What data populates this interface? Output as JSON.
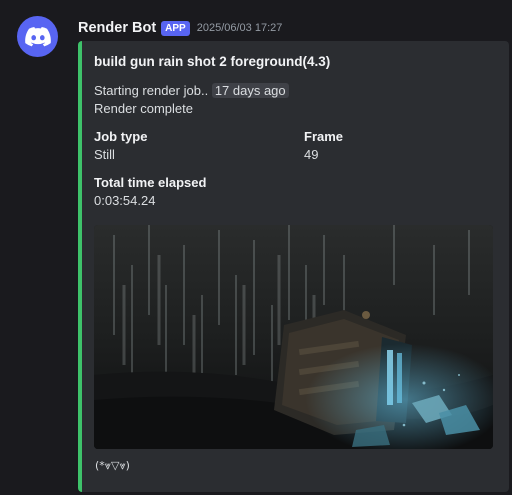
{
  "message": {
    "author": "Render Bot",
    "badge": "APP",
    "timestamp": "2025/06/03 17:27"
  },
  "embed": {
    "accent_color": "#3ec26a",
    "title": "build gun rain shot 2 foreground(4.3)",
    "description_line1_prefix": "Starting render job..",
    "relative_time": "17 days ago",
    "description_line2": "Render complete",
    "fields": [
      {
        "name": "Job type",
        "value": "Still"
      },
      {
        "name": "Frame",
        "value": "49"
      },
      {
        "name": "Total time elapsed",
        "value": "0:03:54.24"
      }
    ],
    "image_icon": "render-preview-image",
    "footer": "(*⩔▽⩔)"
  },
  "colors": {
    "background": "#1a1a1e",
    "embed_bg": "#2b2d31",
    "brand": "#5865f2"
  }
}
